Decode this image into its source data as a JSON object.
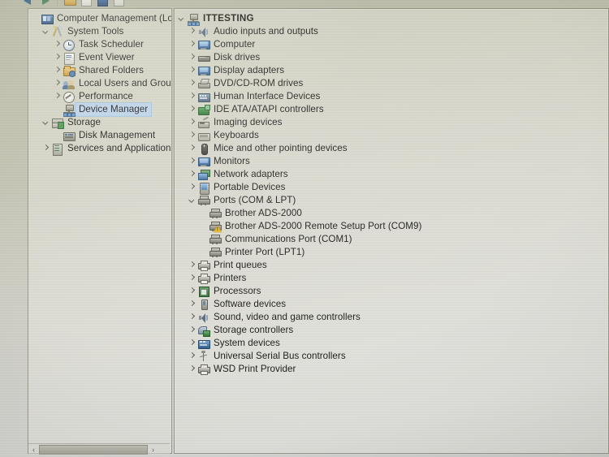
{
  "window": {
    "title": "Computer Management",
    "toolbar": {
      "items": [
        {
          "name": "back-arrow",
          "icon": "back-arrow-icon"
        },
        {
          "name": "forward-arrow",
          "icon": "forward-arrow-icon"
        },
        {
          "name": "show-hide-console-tree",
          "icon": "folder-icon"
        },
        {
          "name": "properties",
          "icon": "document-icon"
        },
        {
          "name": "help",
          "icon": "blue-square-icon"
        },
        {
          "name": "list-view",
          "icon": "grid-icon"
        }
      ]
    }
  },
  "left_pane": {
    "scrollbar": {
      "left_arrow": "‹",
      "right_arrow": "›"
    },
    "tree": [
      {
        "label": "Computer Management (Local",
        "icon": "mmc-console-icon",
        "indent": 0,
        "twisty": "none",
        "selected": false,
        "bold": false
      },
      {
        "label": "System Tools",
        "icon": "system-tools-icon",
        "indent": 1,
        "twisty": "open",
        "selected": false,
        "bold": false
      },
      {
        "label": "Task Scheduler",
        "icon": "clock-icon",
        "indent": 2,
        "twisty": "closed",
        "selected": false,
        "bold": false
      },
      {
        "label": "Event Viewer",
        "icon": "event-log-icon",
        "indent": 2,
        "twisty": "closed",
        "selected": false,
        "bold": false
      },
      {
        "label": "Shared Folders",
        "icon": "shared-folder-icon",
        "indent": 2,
        "twisty": "closed",
        "selected": false,
        "bold": false
      },
      {
        "label": "Local Users and Groups",
        "icon": "users-icon",
        "indent": 2,
        "twisty": "closed",
        "selected": false,
        "bold": false
      },
      {
        "label": "Performance",
        "icon": "performance-icon",
        "indent": 2,
        "twisty": "closed",
        "selected": false,
        "bold": false
      },
      {
        "label": "Device Manager",
        "icon": "device-manager-icon",
        "indent": 2,
        "twisty": "none",
        "selected": true,
        "bold": false
      },
      {
        "label": "Storage",
        "icon": "storage-icon",
        "indent": 1,
        "twisty": "open",
        "selected": false,
        "bold": false
      },
      {
        "label": "Disk Management",
        "icon": "disk-management-icon",
        "indent": 2,
        "twisty": "none",
        "selected": false,
        "bold": false
      },
      {
        "label": "Services and Applications",
        "icon": "services-icon",
        "indent": 1,
        "twisty": "closed",
        "selected": false,
        "bold": false
      }
    ]
  },
  "right_pane": {
    "tree": [
      {
        "label": "ITTESTING",
        "icon": "computer-node-icon",
        "indent": 0,
        "twisty": "open",
        "bold": true,
        "warning": false
      },
      {
        "label": "Audio inputs and outputs",
        "icon": "speaker-icon",
        "indent": 1,
        "twisty": "closed",
        "bold": false,
        "warning": false
      },
      {
        "label": "Computer",
        "icon": "monitor-icon",
        "indent": 1,
        "twisty": "closed",
        "bold": false,
        "warning": false
      },
      {
        "label": "Disk drives",
        "icon": "hard-disk-icon",
        "indent": 1,
        "twisty": "closed",
        "bold": false,
        "warning": false
      },
      {
        "label": "Display adapters",
        "icon": "display-adapter-icon",
        "indent": 1,
        "twisty": "closed",
        "bold": false,
        "warning": false
      },
      {
        "label": "DVD/CD-ROM drives",
        "icon": "optical-drive-icon",
        "indent": 1,
        "twisty": "closed",
        "bold": false,
        "warning": false
      },
      {
        "label": "Human Interface Devices",
        "icon": "hid-icon",
        "indent": 1,
        "twisty": "closed",
        "bold": false,
        "warning": false
      },
      {
        "label": "IDE ATA/ATAPI controllers",
        "icon": "ide-controller-icon",
        "indent": 1,
        "twisty": "closed",
        "bold": false,
        "warning": false
      },
      {
        "label": "Imaging devices",
        "icon": "imaging-device-icon",
        "indent": 1,
        "twisty": "closed",
        "bold": false,
        "warning": false
      },
      {
        "label": "Keyboards",
        "icon": "keyboard-icon",
        "indent": 1,
        "twisty": "closed",
        "bold": false,
        "warning": false
      },
      {
        "label": "Mice and other pointing devices",
        "icon": "mouse-icon",
        "indent": 1,
        "twisty": "closed",
        "bold": false,
        "warning": false
      },
      {
        "label": "Monitors",
        "icon": "monitor-icon",
        "indent": 1,
        "twisty": "closed",
        "bold": false,
        "warning": false
      },
      {
        "label": "Network adapters",
        "icon": "network-adapter-icon",
        "indent": 1,
        "twisty": "closed",
        "bold": false,
        "warning": false
      },
      {
        "label": "Portable Devices",
        "icon": "portable-device-icon",
        "indent": 1,
        "twisty": "closed",
        "bold": false,
        "warning": false
      },
      {
        "label": "Ports (COM & LPT)",
        "icon": "port-icon",
        "indent": 1,
        "twisty": "open",
        "bold": false,
        "warning": false
      },
      {
        "label": "Brother ADS-2000",
        "icon": "port-icon",
        "indent": 2,
        "twisty": "none",
        "bold": false,
        "warning": false
      },
      {
        "label": "Brother ADS-2000 Remote Setup Port (COM9)",
        "icon": "port-icon",
        "indent": 2,
        "twisty": "none",
        "bold": false,
        "warning": true
      },
      {
        "label": "Communications Port (COM1)",
        "icon": "port-icon",
        "indent": 2,
        "twisty": "none",
        "bold": false,
        "warning": false
      },
      {
        "label": "Printer Port (LPT1)",
        "icon": "port-icon",
        "indent": 2,
        "twisty": "none",
        "bold": false,
        "warning": false
      },
      {
        "label": "Print queues",
        "icon": "printer-icon",
        "indent": 1,
        "twisty": "closed",
        "bold": false,
        "warning": false
      },
      {
        "label": "Printers",
        "icon": "printer-icon",
        "indent": 1,
        "twisty": "closed",
        "bold": false,
        "warning": false
      },
      {
        "label": "Processors",
        "icon": "processor-icon",
        "indent": 1,
        "twisty": "closed",
        "bold": false,
        "warning": false
      },
      {
        "label": "Software devices",
        "icon": "software-device-icon",
        "indent": 1,
        "twisty": "closed",
        "bold": false,
        "warning": false
      },
      {
        "label": "Sound, video and game controllers",
        "icon": "speaker-icon",
        "indent": 1,
        "twisty": "closed",
        "bold": false,
        "warning": false
      },
      {
        "label": "Storage controllers",
        "icon": "storage-controller-icon",
        "indent": 1,
        "twisty": "closed",
        "bold": false,
        "warning": false
      },
      {
        "label": "System devices",
        "icon": "system-device-icon",
        "indent": 1,
        "twisty": "closed",
        "bold": false,
        "warning": false
      },
      {
        "label": "Universal Serial Bus controllers",
        "icon": "usb-controller-icon",
        "indent": 1,
        "twisty": "closed",
        "bold": false,
        "warning": false
      },
      {
        "label": "WSD Print Provider",
        "icon": "printer-icon",
        "indent": 1,
        "twisty": "closed",
        "bold": false,
        "warning": false
      }
    ]
  },
  "colors": {
    "selection": "#bcd4ea",
    "warning": "#e8b924",
    "text": "#181814",
    "screen_tint": "#c9c9bd"
  }
}
